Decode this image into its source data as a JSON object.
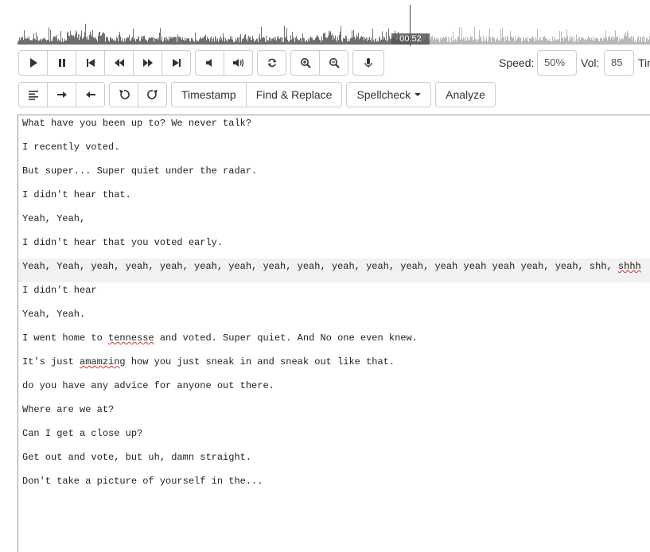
{
  "waveform": {
    "time": "00:52"
  },
  "transport": {
    "icons": [
      "play-icon",
      "pause-icon",
      "skip-start-icon",
      "rewind-icon",
      "fast-forward-icon",
      "skip-end-icon",
      "volume-down-icon",
      "volume-up-icon",
      "loop-icon",
      "zoom-in-icon",
      "zoom-out-icon",
      "microphone-icon"
    ]
  },
  "controls": {
    "speed_label": "Speed:",
    "speed_value": "50%",
    "vol_label": "Vol:",
    "vol_value": "85",
    "third_label": "Tin"
  },
  "edit_toolbar": {
    "timestamp_label": "Timestamp",
    "find_replace_label": "Find & Replace",
    "spellcheck_label": "Spellcheck",
    "analyze_label": "Analyze"
  },
  "editor": {
    "lines": [
      "What have you been up to? We never talk?",
      "I recently voted.",
      "But super... Super quiet under the radar.",
      "I didn't hear that.",
      "Yeah, Yeah,",
      "I didn't hear that you voted early.",
      "Yeah, Yeah, yeah, yeah, yeah, yeah, yeah, yeah, yeah, yeah, yeah, yeah, yeah yeah yeah yeah, yeah, shh, shhh",
      "I didn't hear",
      "Yeah, Yeah.",
      "I went home to tennesse and voted. Super quiet. And No one even knew.",
      "It's just amamzing how you just sneak in and sneak out like that.",
      "do you have any advice for anyone out there.",
      "Where are we at?",
      "Can I get a close up?",
      "Get out and vote, but uh, damn straight.",
      "Don't take a picture of yourself in the..."
    ],
    "highlighted_line": 6,
    "misspelled": [
      "shhh",
      "tennesse",
      "amamzing"
    ]
  }
}
